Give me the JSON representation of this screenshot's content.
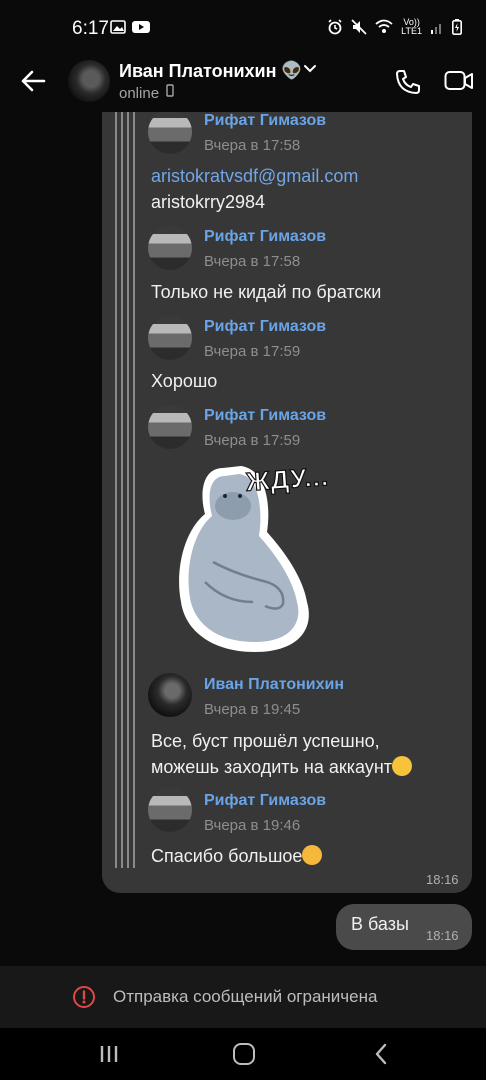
{
  "status_bar": {
    "time": "6:17",
    "lte_top": "Vo))",
    "lte_bottom": "LTE1"
  },
  "header": {
    "contact_name": "Иван Платонихин",
    "contact_emoji": "👽",
    "status": "online"
  },
  "messages": [
    {
      "sender": "Рифат Гимазов",
      "time": "Вчера в 17:58",
      "lines": [
        "aristokratvsdf@gmail.com",
        "aristokrry2984"
      ]
    },
    {
      "sender": "Рифат Гимазов",
      "time": "Вчера в 17:58",
      "lines": [
        "Только не кидай по братски"
      ]
    },
    {
      "sender": "Рифат Гимазов",
      "time": "Вчера в 17:59",
      "lines": [
        "Хорошо"
      ]
    },
    {
      "sender": "Рифат Гимазов",
      "time": "Вчера в 17:59",
      "sticker_text": "ЖДУ..."
    },
    {
      "sender": "Иван Платонихин",
      "time": "Вчера в 19:45",
      "lines": [
        "Все, буст прошёл успешно,",
        "можешь заходить на аккаунт"
      ]
    },
    {
      "sender": "Рифат Гимазов",
      "time": "Вчера в 19:46",
      "lines": [
        "Спасибо большое"
      ]
    }
  ],
  "forward_bubble_time": "18:16",
  "outgoing": {
    "text": "В базы",
    "time": "18:16"
  },
  "restriction": {
    "text": "Отправка сообщений ограничена"
  },
  "colors": {
    "background": "#0a0a0a",
    "incoming_bubble": "#373737",
    "outgoing_bubble": "#4a4a4a",
    "link": "#6aa4e8",
    "warning": "#e04848"
  },
  "icons": [
    "back-arrow-icon",
    "phone-icon",
    "video-call-icon",
    "chevron-down-icon",
    "alert-circle-icon",
    "recents-icon",
    "home-icon",
    "nav-back-icon"
  ]
}
